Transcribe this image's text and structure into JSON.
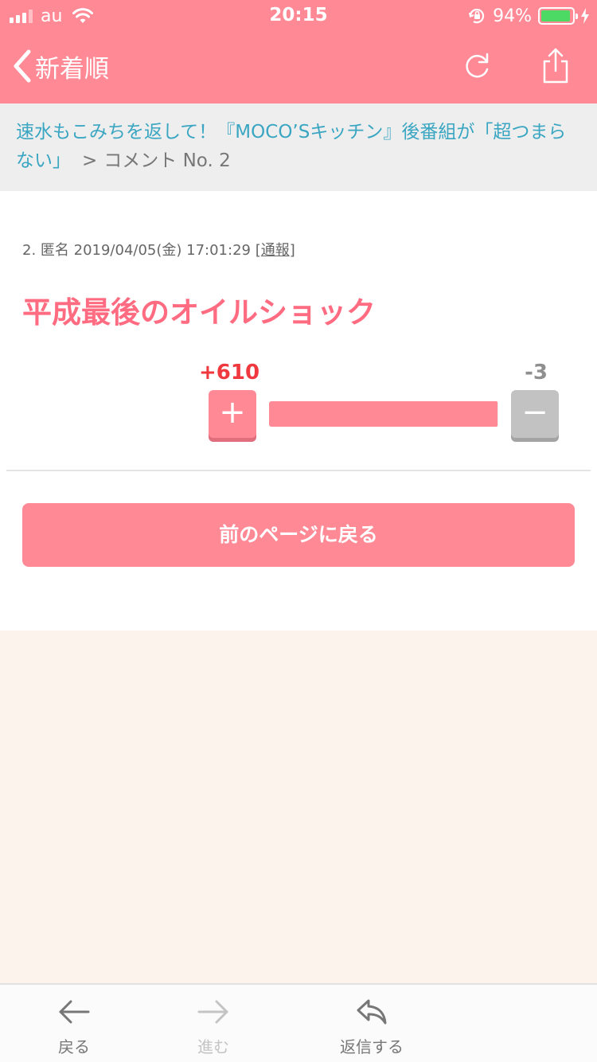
{
  "status_bar": {
    "carrier": "au",
    "time": "20:15",
    "battery_percent": "94%",
    "battery_level": 0.94
  },
  "nav": {
    "back_label": "新着順",
    "refresh_icon": "refresh-icon",
    "share_icon": "share-icon"
  },
  "breadcrumb": {
    "topic_title": "速水もこみちを返して！『MOCO’Sキッチン』後番組が「超つまらない」",
    "separator": ">",
    "current": "コメント No. 2"
  },
  "comment": {
    "meta_prefix": "2. 匿名 2019/04/05(金) 17:01:29 [",
    "report_label": "通報",
    "meta_suffix": "]",
    "body": "平成最後のオイルショック",
    "plus_count": "+610",
    "minus_count": "-3",
    "plus_symbol": "+",
    "minus_symbol": "−",
    "plus_ratio": 0.9951
  },
  "actions": {
    "back_page_label": "前のページに戻る"
  },
  "toolbar": {
    "back_label": "戻る",
    "forward_label": "進む",
    "reply_label": "返信する"
  },
  "colors": {
    "accent": "#ff8a96",
    "comment_text": "#ff6b80",
    "plus_count": "#f0383f",
    "link": "#3aa6c2",
    "footer_bg": "#fbf3ec"
  }
}
